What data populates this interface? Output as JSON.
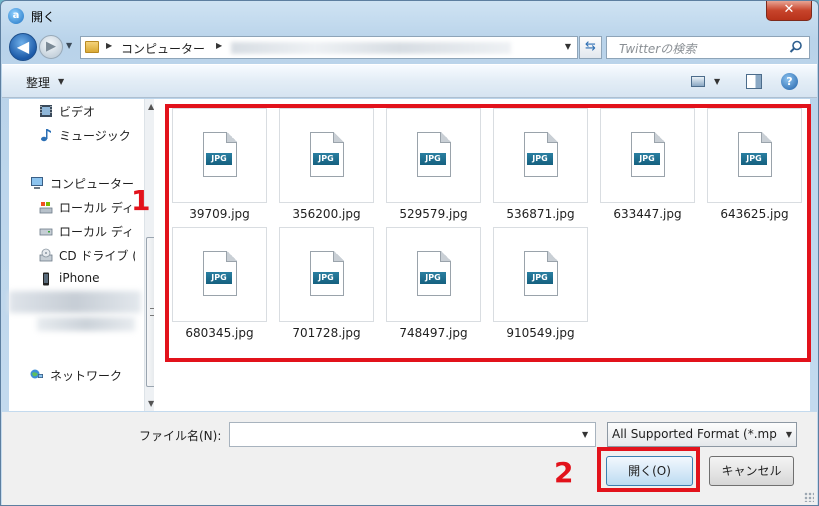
{
  "window": {
    "title": "開く",
    "close_label": "✕"
  },
  "address": {
    "crumbs": [
      "コンピューター"
    ]
  },
  "search": {
    "placeholder": "Twitterの検索"
  },
  "toolbar": {
    "organize_label": "整理"
  },
  "nav": {
    "items": [
      {
        "label": "ビデオ",
        "icon": "video-icon"
      },
      {
        "label": "ミュージック",
        "icon": "music-icon"
      },
      {
        "label": "コンピューター",
        "icon": "computer-icon"
      },
      {
        "label": "ローカル ディ",
        "icon": "local-disk-icon"
      },
      {
        "label": "ローカル ディ",
        "icon": "local-disk-icon"
      },
      {
        "label": "CD ドライブ (",
        "icon": "cd-drive-icon"
      },
      {
        "label": "iPhone",
        "icon": "phone-icon"
      },
      {
        "label": "ネットワーク",
        "icon": "network-icon"
      }
    ]
  },
  "files": [
    {
      "name": "39709.jpg",
      "badge": "JPG"
    },
    {
      "name": "356200.jpg",
      "badge": "JPG"
    },
    {
      "name": "529579.jpg",
      "badge": "JPG"
    },
    {
      "name": "536871.jpg",
      "badge": "JPG"
    },
    {
      "name": "633447.jpg",
      "badge": "JPG"
    },
    {
      "name": "643625.jpg",
      "badge": "JPG"
    },
    {
      "name": "680345.jpg",
      "badge": "JPG"
    },
    {
      "name": "701728.jpg",
      "badge": "JPG"
    },
    {
      "name": "748497.jpg",
      "badge": "JPG"
    },
    {
      "name": "910549.jpg",
      "badge": "JPG"
    }
  ],
  "footer": {
    "filename_label": "ファイル名(N):",
    "filename_value": "",
    "filter_label": "All Supported Format (*.mp",
    "open_label": "開く(O)",
    "cancel_label": "キャンセル"
  },
  "annotations": {
    "marker1": "1",
    "marker2": "2",
    "color": "#e2121b"
  }
}
